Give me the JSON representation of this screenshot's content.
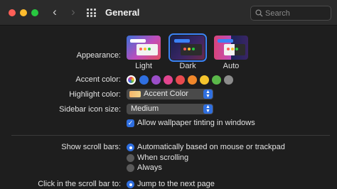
{
  "window": {
    "title": "General"
  },
  "search": {
    "placeholder": "Search"
  },
  "appearance": {
    "label": "Appearance:",
    "options": [
      {
        "name": "Light",
        "selected": false
      },
      {
        "name": "Dark",
        "selected": true
      },
      {
        "name": "Auto",
        "selected": false
      }
    ]
  },
  "accent": {
    "label": "Accent color:",
    "colors": [
      "multicolor",
      "#2f6fe0",
      "#9b4ec8",
      "#e2458f",
      "#e84a4f",
      "#f0872b",
      "#f5c42d",
      "#5bb84a",
      "#8c8c8c"
    ]
  },
  "highlight": {
    "label": "Highlight color:",
    "value": "Accent Color"
  },
  "sidebar_icon": {
    "label": "Sidebar icon size:",
    "value": "Medium"
  },
  "wallpaper_tinting": {
    "label": "Allow wallpaper tinting in windows",
    "checked": true
  },
  "scroll_bars": {
    "label": "Show scroll bars:",
    "options": [
      {
        "label": "Automatically based on mouse or trackpad",
        "selected": true
      },
      {
        "label": "When scrolling",
        "selected": false
      },
      {
        "label": "Always",
        "selected": false
      }
    ]
  },
  "click_scroll": {
    "label": "Click in the scroll bar to:",
    "options": [
      {
        "label": "Jump to the next page",
        "selected": true
      }
    ]
  }
}
